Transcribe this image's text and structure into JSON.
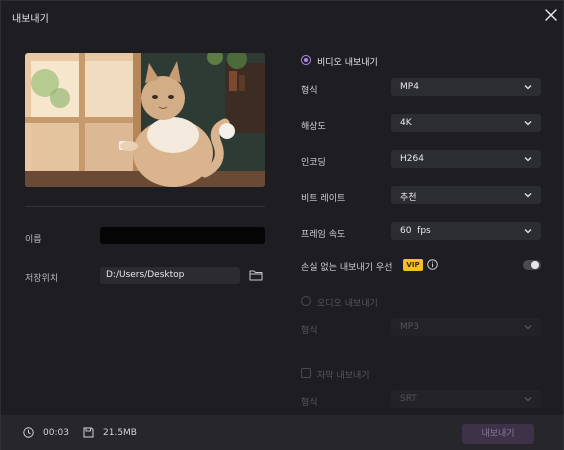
{
  "dialog": {
    "title": "내보내기"
  },
  "left": {
    "name_label": "이름",
    "name_value": "",
    "location_label": "저장위치",
    "location_value": "D:/Users/Desktop"
  },
  "video": {
    "section_label": "비디오 내보내기",
    "rows": [
      {
        "label": "형식",
        "value": "MP4"
      },
      {
        "label": "해상도",
        "value": "4K"
      },
      {
        "label": "인코딩",
        "value": "H264"
      },
      {
        "label": "비트 레이트",
        "value": "추천"
      },
      {
        "label": "프레임 속도",
        "value": "60  fps"
      }
    ],
    "lossless_label": "손실 없는 내보내기 우선",
    "vip_badge": "VIP",
    "lossless_enabled": false
  },
  "audio": {
    "section_label": "오디오 내보내기",
    "format_label": "형식",
    "format_value": "MP3"
  },
  "subtitle": {
    "section_label": "자막 내보내기",
    "format_label": "형식",
    "format_value": "SRT"
  },
  "footer": {
    "duration": "00:03",
    "size": "21.5MB",
    "export_label": "내보내기"
  },
  "colors": {
    "accent": "#b08af0",
    "vip": "#f4c21f",
    "export_button": "#3d3247"
  }
}
